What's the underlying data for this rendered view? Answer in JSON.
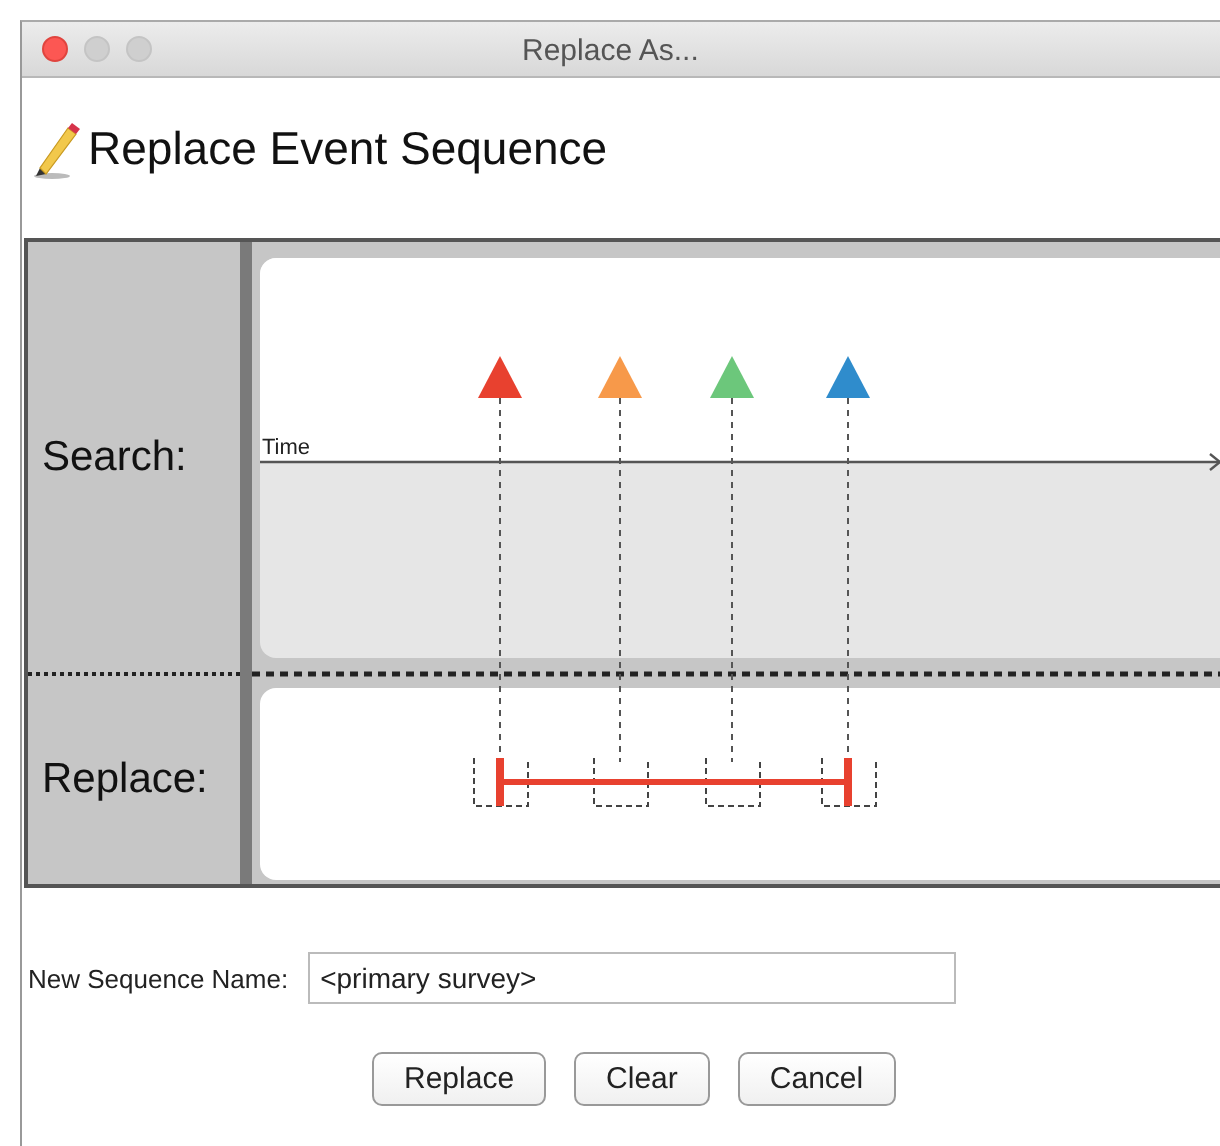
{
  "window": {
    "title": "Replace As..."
  },
  "heading": "Replace Event Sequence",
  "rows": [
    {
      "label": "Search:"
    },
    {
      "label": "Replace:"
    }
  ],
  "axis_label": "Time",
  "events": [
    {
      "color": "#e8412f"
    },
    {
      "color": "#f7994a"
    },
    {
      "color": "#6cc77b"
    },
    {
      "color": "#2f8ccc"
    }
  ],
  "replacement": {
    "color": "#e8412f"
  },
  "name_field": {
    "label": "New Sequence Name:",
    "value": "<primary survey>"
  },
  "buttons": [
    "Replace",
    "Clear",
    "Cancel"
  ]
}
